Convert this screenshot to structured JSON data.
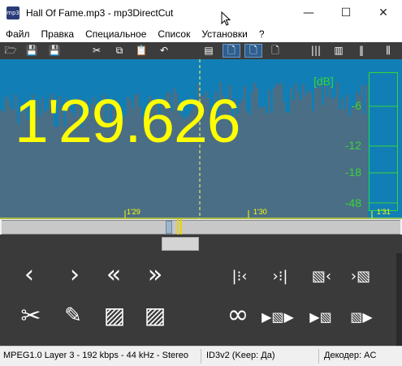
{
  "window": {
    "app_icon_label": "mp3",
    "title": "Hall Of Fame.mp3 - mp3DirectCut",
    "minimize_glyph": "—",
    "maximize_glyph": "☐",
    "close_glyph": "✕"
  },
  "menu": {
    "items": [
      "Файл",
      "Правка",
      "Специальное",
      "Список",
      "Установки",
      "?"
    ]
  },
  "toolbar": {
    "icons": [
      {
        "name": "open-folder-icon",
        "glyph": "🗁"
      },
      {
        "name": "save-volume-icon",
        "glyph": "💾"
      },
      {
        "name": "save-list-icon",
        "glyph": "💾"
      },
      {
        "name": "cut-icon",
        "glyph": "✂"
      },
      {
        "name": "copy-icon",
        "glyph": "⧉"
      },
      {
        "name": "paste-icon",
        "glyph": "📋"
      },
      {
        "name": "undo-icon",
        "glyph": "↶"
      },
      {
        "name": "page-icon",
        "glyph": "▤"
      },
      {
        "name": "page-b-icon",
        "glyph": "🗋"
      },
      {
        "name": "page-c-icon",
        "glyph": "🗋"
      },
      {
        "name": "page-d-icon",
        "glyph": "🗋"
      },
      {
        "name": "meter-bars-icon",
        "glyph": "|||"
      },
      {
        "name": "meter-bars-2-icon",
        "glyph": "▥"
      },
      {
        "name": "pause-bars-icon",
        "glyph": "‖"
      },
      {
        "name": "columns-icon",
        "glyph": "⫼"
      }
    ]
  },
  "display": {
    "time": "1'29.626",
    "db_unit": "[dB]",
    "db_scale": [
      "-6",
      "-12",
      "-18",
      "-48"
    ],
    "timeline_ticks": [
      "1'29",
      "1'30",
      "1'31"
    ],
    "colors": {
      "background": "#117fb5",
      "waveform": "#4a6e86",
      "time_text": "#ffff00",
      "meter": "#37d637"
    }
  },
  "controls": {
    "row1": [
      {
        "name": "prev-frame-button",
        "glyph": "‹"
      },
      {
        "name": "next-frame-button",
        "glyph": "›"
      },
      {
        "name": "rewind-button",
        "glyph": "«"
      },
      {
        "name": "fast-forward-button",
        "glyph": "»"
      },
      {
        "name": "goto-begin-selection-button",
        "glyph": "|⁝‹"
      },
      {
        "name": "goto-end-selection-button",
        "glyph": "›⁝|"
      },
      {
        "name": "selection-start-button",
        "glyph": "▧‹"
      },
      {
        "name": "selection-end-button",
        "glyph": "›▧"
      }
    ],
    "row2": [
      {
        "name": "cut-button",
        "glyph": "✂"
      },
      {
        "name": "edit-pencil-button",
        "glyph": "✎"
      },
      {
        "name": "fade-in-button",
        "glyph": "▨"
      },
      {
        "name": "fade-out-button",
        "glyph": "▨"
      },
      {
        "name": "loop-button",
        "glyph": "∞"
      },
      {
        "name": "play-selection-button",
        "glyph": "▶▧▶"
      },
      {
        "name": "play-to-end-button",
        "glyph": "▶▧"
      },
      {
        "name": "play-button",
        "glyph": "▧▶"
      }
    ]
  },
  "statusbar": {
    "format": "MPEG1.0 Layer 3 - 192 kbps - 44 kHz - Stereo",
    "tags": "ID3v2 (Keep: Да)",
    "decoder": "Декодер: AC"
  }
}
